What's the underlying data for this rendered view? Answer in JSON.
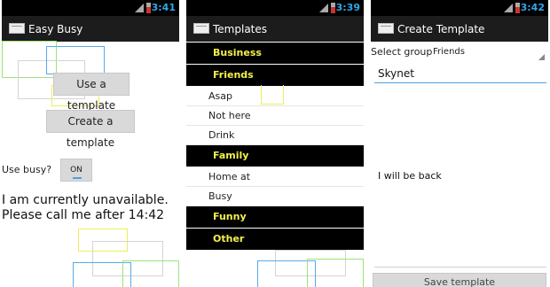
{
  "colors": {
    "status_time": "#2fa8e8",
    "group_text": "#f2f24a",
    "field_underline": "#4aa3df"
  },
  "phone1": {
    "status_time": "3:41",
    "title": "Easy Busy",
    "use_template_button": "Use a template",
    "create_template_button": "Create a template",
    "use_busy_label": "Use busy?",
    "toggle_state": "ON",
    "message_line1": "I am currently unavailable.",
    "message_line2": "Please call me after 14:42"
  },
  "phone2": {
    "status_time": "3:39",
    "title": "Templates",
    "groups": {
      "business": "Business",
      "friends": "Friends",
      "family": "Family",
      "funny": "Funny",
      "other": "Other"
    },
    "friends_items": [
      "Asap",
      "Not here",
      "Drink"
    ],
    "family_items": [
      "Home at",
      "Busy"
    ]
  },
  "phone3": {
    "status_time": "3:42",
    "title": "Create Template",
    "select_group_label": "Select group",
    "selected_group": "Friends",
    "name_value": "Skynet",
    "message_value": "I will be back",
    "save_button": "Save template"
  },
  "icons": [
    "signal-icon",
    "battery-icon",
    "app-icon",
    "dropdown-arrow-icon"
  ]
}
